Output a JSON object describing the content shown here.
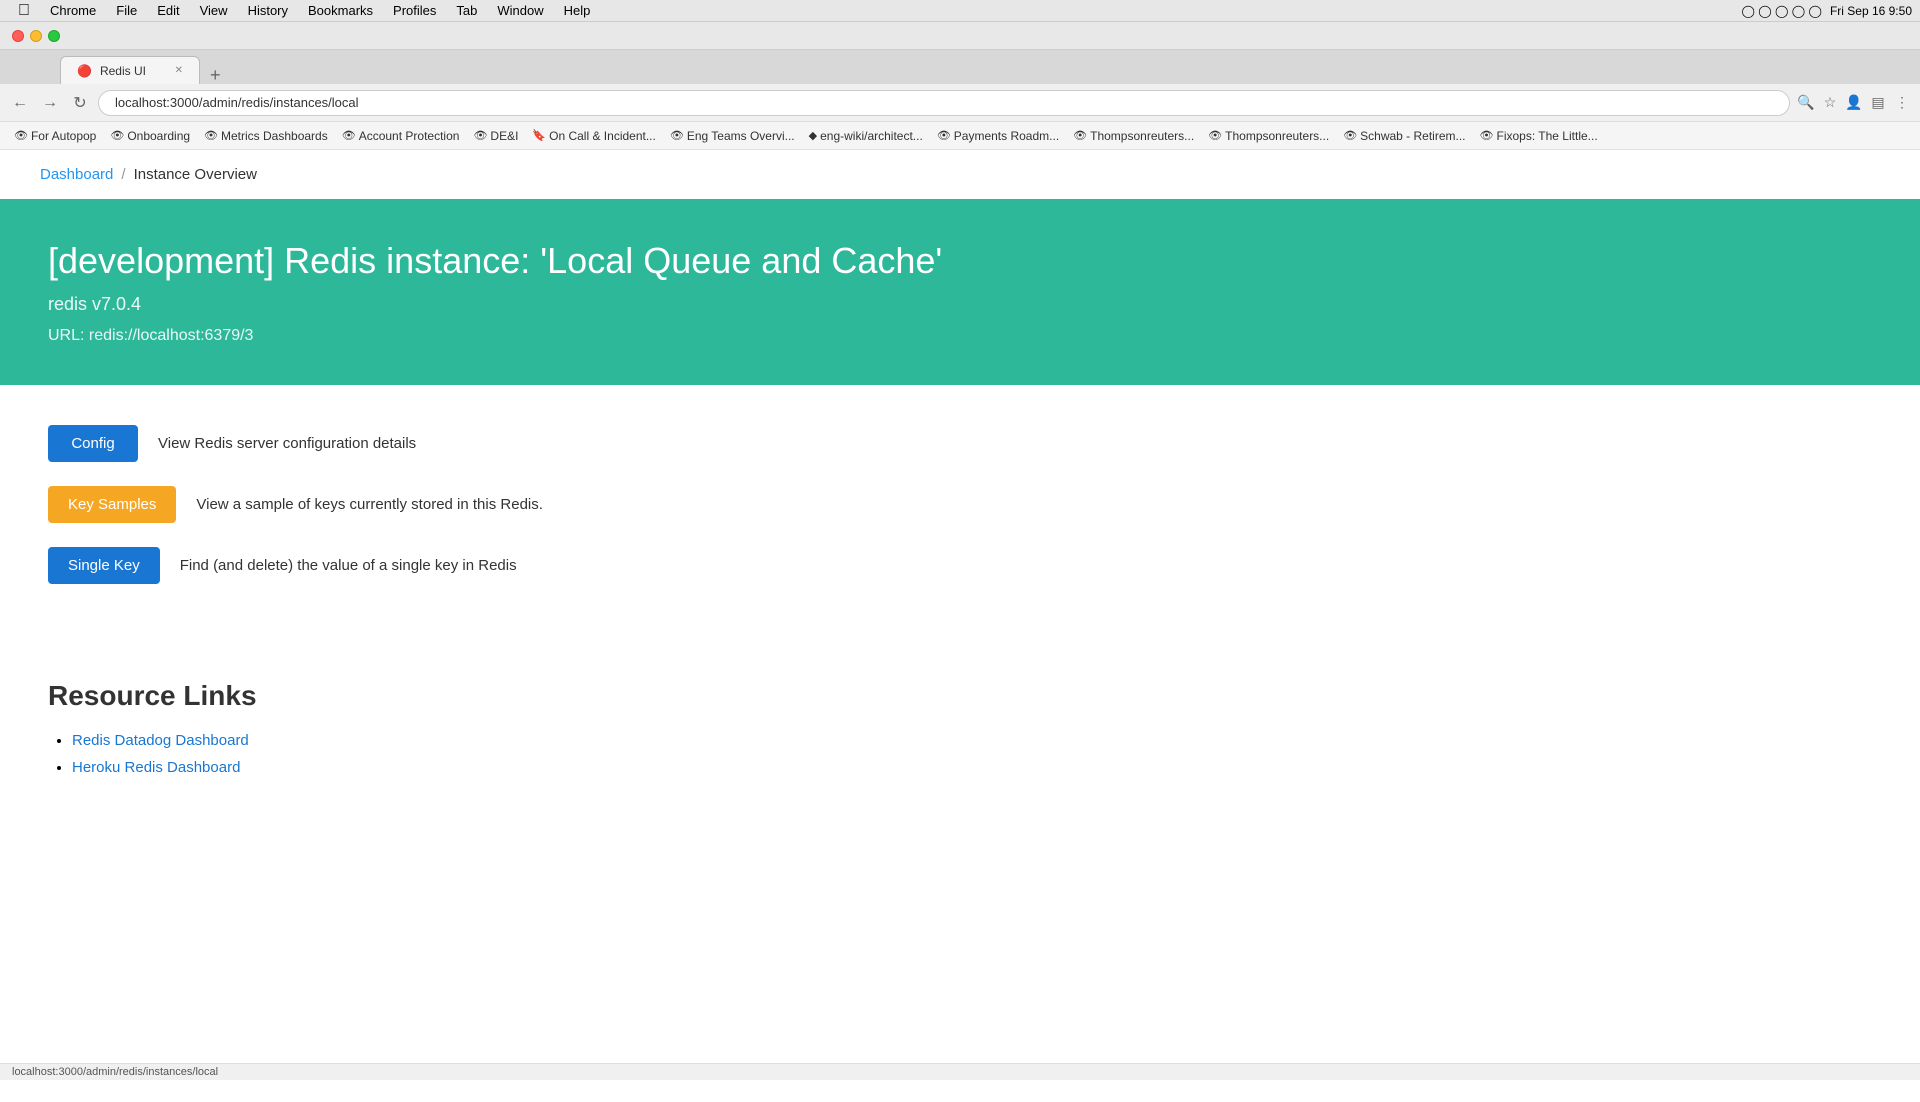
{
  "menubar": {
    "apple": "&#63743;",
    "items": [
      "Chrome",
      "File",
      "Edit",
      "View",
      "History",
      "Bookmarks",
      "Profiles",
      "Tab",
      "Window",
      "Help"
    ],
    "datetime": "Fri Sep 16  9:50"
  },
  "browser": {
    "tab_title": "Redis UI",
    "url": "localhost:3000/admin/redis/instances/local",
    "new_tab_label": "+"
  },
  "bookmarks": [
    {
      "label": "For Autopop",
      "icon": "★"
    },
    {
      "label": "Onboarding",
      "icon": "★"
    },
    {
      "label": "Metrics Dashboards",
      "icon": "★"
    },
    {
      "label": "Account Protection",
      "icon": "★"
    },
    {
      "label": "DE&I",
      "icon": "★"
    },
    {
      "label": "On Call & Incident...",
      "icon": "★"
    },
    {
      "label": "Eng Teams Overvi...",
      "icon": "★"
    },
    {
      "label": "eng-wiki/architect...",
      "icon": "♦"
    },
    {
      "label": "Payments Roadm...",
      "icon": "★"
    },
    {
      "label": "Thompsonreuters...",
      "icon": "★"
    },
    {
      "label": "Thompsonreuters...",
      "icon": "★"
    },
    {
      "label": "Schwab - Retirem...",
      "icon": "★"
    },
    {
      "label": "Fixops: The Little...",
      "icon": "★"
    }
  ],
  "breadcrumb": {
    "home": "Dashboard",
    "separator": "/",
    "current": "Instance Overview"
  },
  "hero": {
    "title": "[development] Redis instance: 'Local Queue and Cache'",
    "version": "redis v7.0.4",
    "url_label": "URL:",
    "url_value": "redis://localhost:6379/3"
  },
  "actions": [
    {
      "button_label": "Config",
      "button_type": "config",
      "description": "View Redis server configuration details"
    },
    {
      "button_label": "Key Samples",
      "button_type": "keysamples",
      "description": "View a sample of keys currently stored in this Redis."
    },
    {
      "button_label": "Single Key",
      "button_type": "singlekey",
      "description": "Find (and delete) the value of a single key in Redis"
    }
  ],
  "resources": {
    "title": "Resource Links",
    "links": [
      {
        "label": "Redis Datadog Dashboard",
        "href": "#"
      },
      {
        "label": "Heroku Redis Dashboard",
        "href": "#"
      }
    ]
  },
  "statusbar": {
    "url": "localhost:3000/admin/redis/instances/local"
  }
}
